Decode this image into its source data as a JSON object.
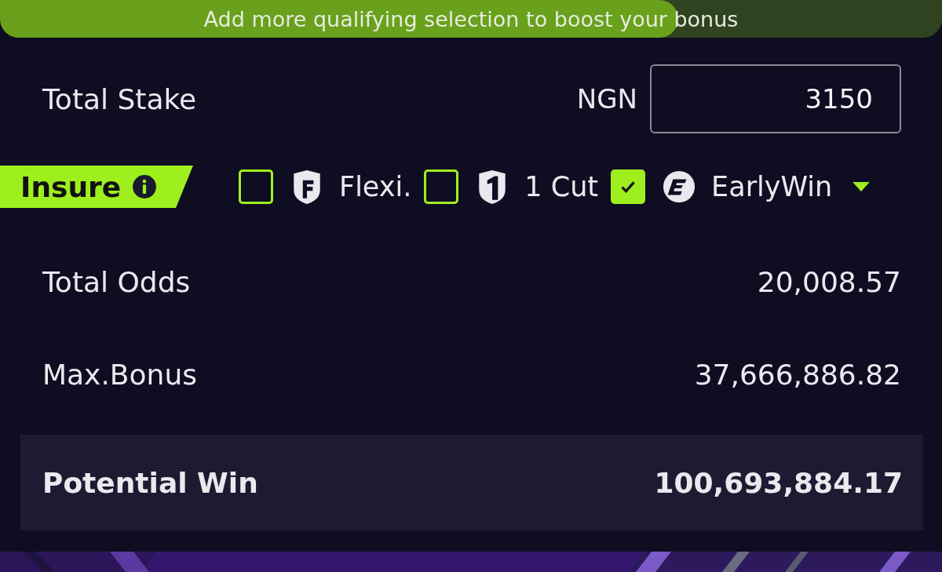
{
  "banner": {
    "text": "Add more qualifying selection to boost your bonus",
    "level": 0.72
  },
  "stake": {
    "label": "Total Stake",
    "currency": "NGN",
    "value": "3150"
  },
  "insure": {
    "label": "Insure",
    "options": [
      {
        "kind": "flexi",
        "label": "Flexi.",
        "checked": false
      },
      {
        "kind": "cut",
        "label": "1 Cut",
        "checked": false
      },
      {
        "kind": "early",
        "label": "EarlyWin",
        "checked": true
      }
    ]
  },
  "summary": [
    {
      "label": "Total Odds",
      "value": "20,008.57"
    },
    {
      "label": "Max.Bonus",
      "value": "37,666,886.82"
    }
  ],
  "potential_win": {
    "label": "Potential Win",
    "value": "100,693,884.17"
  }
}
